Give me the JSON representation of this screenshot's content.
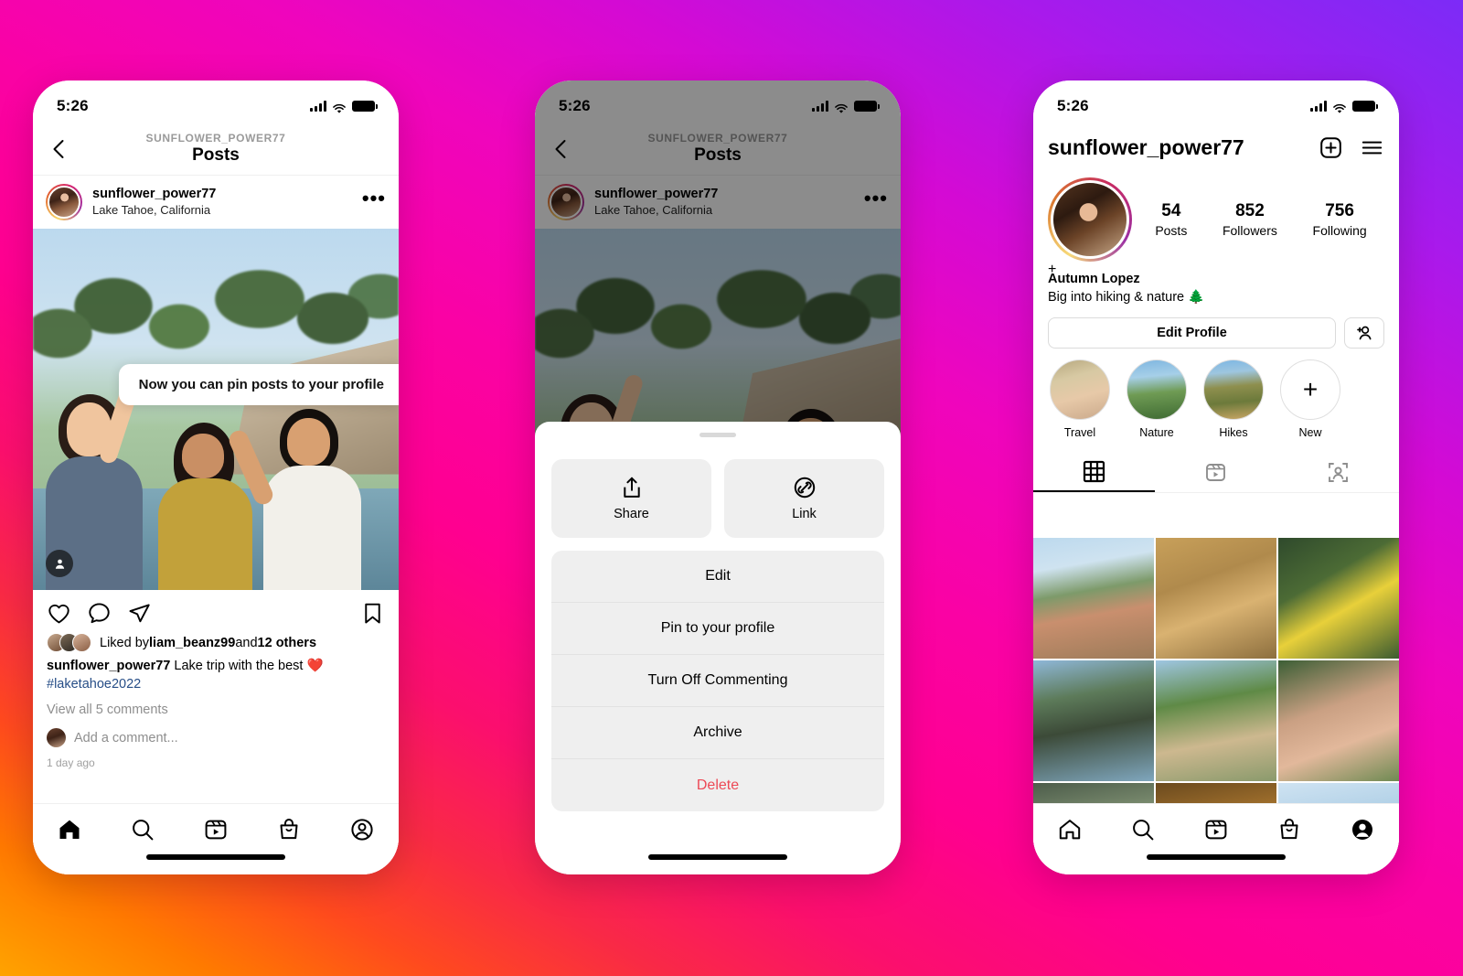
{
  "background": {
    "gradient_from": "#ffa300",
    "gradient_mid": "#ff0090",
    "gradient_to": "#7c2bf7"
  },
  "phone1": {
    "status": {
      "time": "5:26",
      "signal_icon": "cellular-bars-icon",
      "wifi_icon": "wifi-icon",
      "battery_icon": "battery-icon"
    },
    "nav": {
      "back_icon": "chevron-left-icon",
      "kicker": "SUNFLOWER_POWER77",
      "title": "Posts"
    },
    "post_header": {
      "username": "sunflower_power77",
      "location": "Lake Tahoe, California",
      "more_icon": "more-options-icon"
    },
    "tooltip": {
      "text": "Now you can pin posts to your profile"
    },
    "photo": {
      "tag_icon": "person-tag-icon"
    },
    "actions": {
      "like_icon": "heart-icon",
      "comment_icon": "comment-icon",
      "share_icon": "share-paper-plane-icon",
      "save_icon": "bookmark-icon"
    },
    "likes": {
      "prefix": "Liked by ",
      "user": "liam_beanz99",
      "middle": " and ",
      "count": "12 others"
    },
    "caption": {
      "username": "sunflower_power77",
      "text": " Lake trip with the best ❤️",
      "hashtag": "#laketahoe2022"
    },
    "view_comments": "View all 5 comments",
    "add_comment_placeholder": "Add a comment...",
    "time_ago": "1 day ago",
    "tabbar": [
      "home-icon",
      "search-icon",
      "reels-icon",
      "shop-icon",
      "profile-icon"
    ]
  },
  "phone2": {
    "status": {
      "time": "5:26"
    },
    "nav": {
      "kicker": "SUNFLOWER_POWER77",
      "title": "Posts"
    },
    "post_header": {
      "username": "sunflower_power77",
      "location": "Lake Tahoe, California"
    },
    "sheet": {
      "grabber": "drag-handle",
      "quick_actions": [
        {
          "icon": "share-upload-icon",
          "label": "Share"
        },
        {
          "icon": "link-chain-icon",
          "label": "Link"
        }
      ],
      "menu_items": [
        {
          "label": "Edit",
          "danger": false
        },
        {
          "label": "Pin to your profile",
          "danger": false
        },
        {
          "label": "Turn Off Commenting",
          "danger": false
        },
        {
          "label": "Archive",
          "danger": false
        },
        {
          "label": "Delete",
          "danger": true
        }
      ]
    }
  },
  "phone3": {
    "status": {
      "time": "5:26"
    },
    "header": {
      "username": "sunflower_power77",
      "add_icon": "plus-square-icon",
      "menu_icon": "hamburger-menu-icon"
    },
    "avatar": {
      "add_story_icon": "plus-icon"
    },
    "stats": [
      {
        "number": "54",
        "label": "Posts"
      },
      {
        "number": "852",
        "label": "Followers"
      },
      {
        "number": "756",
        "label": "Following"
      }
    ],
    "bio": {
      "name": "Autumn Lopez",
      "text": "Big into hiking & nature 🌲"
    },
    "buttons": {
      "edit_profile": "Edit Profile",
      "add_person_icon": "add-person-icon"
    },
    "highlights": [
      {
        "label": "Travel",
        "style": "hl-travel"
      },
      {
        "label": "Nature",
        "style": "hl-nature"
      },
      {
        "label": "Hikes",
        "style": "hl-hikes"
      },
      {
        "label": "New",
        "style": "hl-new"
      }
    ],
    "tabs": [
      {
        "icon": "grid-icon",
        "active": true
      },
      {
        "icon": "reels-icon",
        "active": false
      },
      {
        "icon": "tagged-icon",
        "active": false
      }
    ],
    "grid": [
      {
        "style": "g1"
      },
      {
        "style": "g2"
      },
      {
        "style": "g3"
      },
      {
        "style": "g4"
      },
      {
        "style": "g5"
      },
      {
        "style": "g6"
      },
      {
        "style": "g7"
      },
      {
        "style": "g8"
      },
      {
        "style": "g9"
      }
    ],
    "tabbar": [
      "home-icon",
      "search-icon",
      "reels-icon",
      "shop-icon",
      "profile-icon-filled"
    ]
  }
}
